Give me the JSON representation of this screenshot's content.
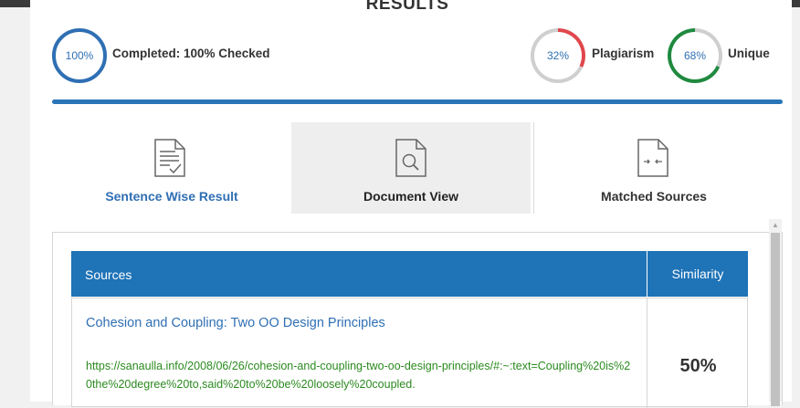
{
  "page": {
    "title": "RESULTS"
  },
  "stats": {
    "completed": {
      "ring_text": "100%",
      "label": "Completed: 100% Checked",
      "value": 100
    },
    "plagiarism": {
      "ring_text": "32%",
      "label": "Plagiarism",
      "value": 32,
      "color": "#e0474c"
    },
    "unique": {
      "ring_text": "68%",
      "label": "Unique",
      "value": 68,
      "color": "#1f8a3f"
    }
  },
  "progress": {
    "value": 100,
    "color": "#2a74b8"
  },
  "tabs": [
    {
      "label": "Sentence Wise Result",
      "icon": "document-check-icon",
      "active": false
    },
    {
      "label": "Document View",
      "icon": "document-search-icon",
      "active": true
    },
    {
      "label": "Matched Sources",
      "icon": "document-compare-icon",
      "active": false
    }
  ],
  "table": {
    "headers": {
      "sources": "Sources",
      "similarity": "Similarity"
    },
    "rows": [
      {
        "title": "Cohesion and Coupling: Two OO Design Principles",
        "url": "https://sanaulla.info/2008/06/26/cohesion-and-coupling-two-oo-design-principles/#:~:text=Coupling%20is%20the%20degree%20to,said%20to%20be%20loosely%20coupled.",
        "similarity": "50%"
      }
    ]
  },
  "colors": {
    "accent": "#2f6fb4",
    "table_header": "#1f73b7",
    "url_green": "#2b8a1f"
  }
}
